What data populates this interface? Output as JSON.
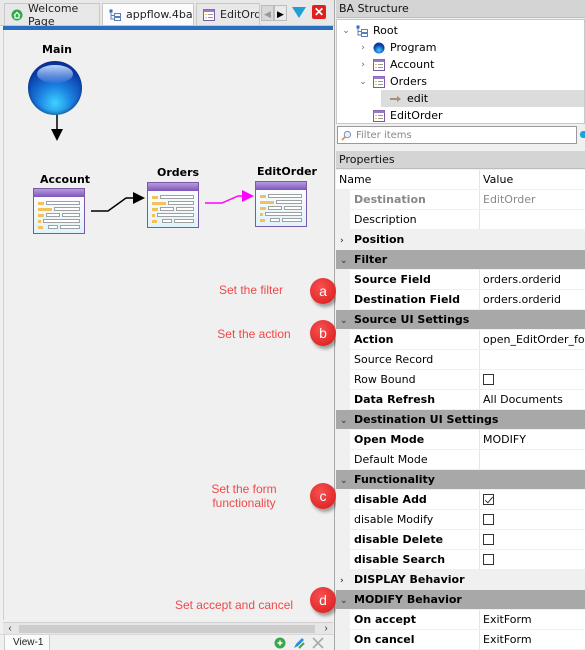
{
  "editor": {
    "tabs": [
      {
        "label": "Welcome Page",
        "icon": "home-icon",
        "active": false
      },
      {
        "label": "appflow.4ba",
        "icon": "flow-icon",
        "active": true
      },
      {
        "label": "EditOrder.",
        "icon": "form-icon",
        "active": false
      }
    ],
    "diagram": {
      "nodes": [
        {
          "id": "main",
          "label": "Main",
          "type": "program"
        },
        {
          "id": "account",
          "label": "Account",
          "type": "form"
        },
        {
          "id": "orders",
          "label": "Orders",
          "type": "form"
        },
        {
          "id": "editorder",
          "label": "EditOrder",
          "type": "form"
        }
      ],
      "edges": [
        {
          "from": "main",
          "to": "account",
          "color": "#000000"
        },
        {
          "from": "account",
          "to": "orders",
          "color": "#000000"
        },
        {
          "from": "orders",
          "to": "editorder",
          "color": "#ff00ff",
          "selected": true
        }
      ]
    },
    "annotations": [
      {
        "badge": "a",
        "text": "Set the filter"
      },
      {
        "badge": "b",
        "text": "Set the action"
      },
      {
        "badge": "c",
        "text": "Set the form functionality"
      },
      {
        "badge": "d",
        "text": "Set  accept and cancel"
      }
    ],
    "view_tab": "View-1"
  },
  "structure": {
    "title": "BA Structure",
    "tree": [
      {
        "label": "Root",
        "icon": "flow-icon",
        "twisty": "open",
        "level": 0
      },
      {
        "label": "Program",
        "icon": "globe-icon",
        "twisty": "closed",
        "level": 1
      },
      {
        "label": "Account",
        "icon": "form-icon",
        "twisty": "closed",
        "level": 1
      },
      {
        "label": "Orders",
        "icon": "form-icon",
        "twisty": "open",
        "level": 1
      },
      {
        "label": "edit",
        "icon": "arrow-icon",
        "twisty": "none",
        "level": 2,
        "selected": true
      },
      {
        "label": "EditOrder",
        "icon": "form-icon",
        "twisty": "none",
        "level": 1
      }
    ],
    "filter_placeholder": "Filter items"
  },
  "properties": {
    "title": "Properties",
    "header": {
      "name": "Name",
      "value": "Value"
    },
    "rows": [
      {
        "kind": "ro",
        "name": "Destination",
        "value": "EditOrder"
      },
      {
        "kind": "plain",
        "name": "Description",
        "value": ""
      },
      {
        "kind": "cat",
        "name": "Position",
        "open": false
      },
      {
        "kind": "cat",
        "name": "Filter",
        "open": true
      },
      {
        "kind": "bold",
        "name": "Source Field",
        "value": "orders.orderid"
      },
      {
        "kind": "bold",
        "name": "Destination Field",
        "value": "orders.orderid"
      },
      {
        "kind": "cat",
        "name": "Source UI Settings",
        "open": true
      },
      {
        "kind": "bold",
        "name": "Action",
        "value": "open_EditOrder_form"
      },
      {
        "kind": "plain",
        "name": "Source Record",
        "value": ""
      },
      {
        "kind": "plain",
        "name": "Row Bound",
        "checkbox": false
      },
      {
        "kind": "bold",
        "name": "Data Refresh",
        "value": "All Documents"
      },
      {
        "kind": "cat",
        "name": "Destination UI Settings",
        "open": true
      },
      {
        "kind": "bold",
        "name": "Open Mode",
        "value": "MODIFY"
      },
      {
        "kind": "plain",
        "name": "Default Mode",
        "value": ""
      },
      {
        "kind": "cat",
        "name": "Functionality",
        "open": true
      },
      {
        "kind": "bold",
        "name": "disable Add",
        "checkbox": true
      },
      {
        "kind": "plain",
        "name": "disable Modify",
        "checkbox": false
      },
      {
        "kind": "bold",
        "name": "disable Delete",
        "checkbox": false
      },
      {
        "kind": "bold",
        "name": "disable Search",
        "checkbox": false
      },
      {
        "kind": "cat",
        "name": "DISPLAY Behavior",
        "open": false
      },
      {
        "kind": "cat",
        "name": "MODIFY Behavior",
        "open": true
      },
      {
        "kind": "bold",
        "name": "On accept",
        "value": "ExitForm"
      },
      {
        "kind": "bold",
        "name": "On cancel",
        "value": "ExitForm"
      }
    ]
  }
}
